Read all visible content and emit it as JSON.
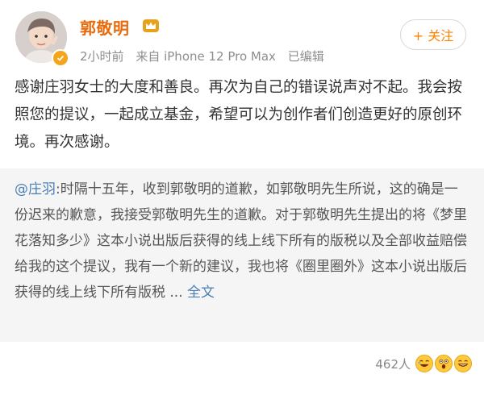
{
  "post": {
    "username": "郭敬明",
    "time": "2小时前",
    "source": "来自 iPhone 12 Pro Max",
    "edited": "已编辑",
    "follow_label": "+ 关注",
    "text": "感谢庄羽女士的大度和善良。再次为自己的错误说声对不起。我会按照您的提议，一起成立基金，希望可以为创作者们创造更好的原创环境。再次感谢。"
  },
  "quote": {
    "mention": "@庄羽",
    "text": ":时隔十五年，收到郭敬明的道歉，如郭敬明先生所说，这的确是一份迟来的歉意，我接受郭敬明先生的道歉。对于郭敬明先生提出的将《梦里花落知多少》这本小说出版后获得的线上线下所有的版税以及全部收益赔偿给我的这个提议，我有一个新的建议，我也将《圈里圈外》这本小说出版后获得的线上线下所有版税 ... ",
    "more_label": "全文"
  },
  "footer": {
    "like_count": "462人",
    "reaction_icons": [
      "laugh-emoji-icon",
      "surprised-emoji-icon",
      "grin-emoji-icon"
    ]
  },
  "colors": {
    "username": "#e86b0d",
    "follow": "#ff8200",
    "link": "#4a7fb5",
    "quote_bg": "#f5f5f5"
  }
}
